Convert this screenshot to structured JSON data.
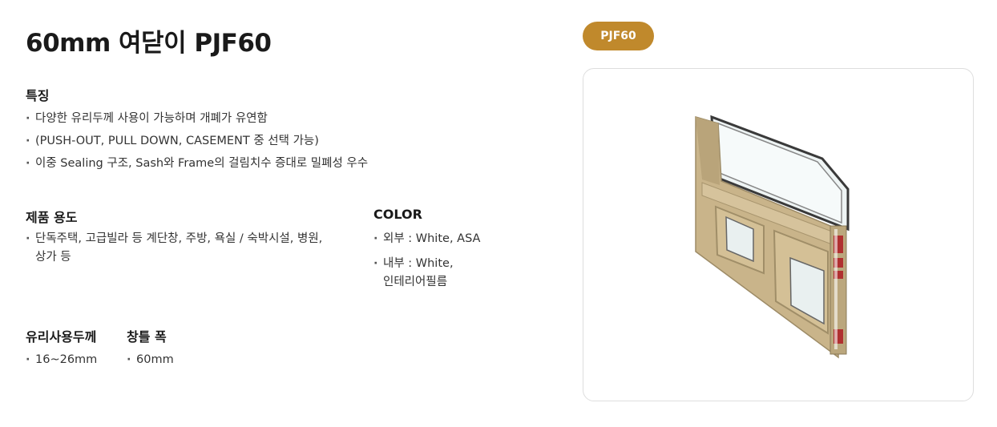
{
  "product": {
    "title": "60mm 여닫이 PJF60",
    "badge": "PJF60",
    "image_icon": "window-frame-product-image"
  },
  "features": {
    "heading": "특징",
    "items": [
      "다양한 유리두께 사용이 가능하며 개폐가 유연함",
      "(PUSH-OUT, PULL DOWN, CASEMENT 중 선택 가능)",
      "이중 Sealing 구조, Sash와 Frame의 걸림치수 증대로 밀폐성 우수"
    ]
  },
  "usage": {
    "heading": "제품 용도",
    "items": [
      {
        "line1": "단독주택, 고급빌라 등 계단창, 주방, 욕실 / 숙박시설, 병원,",
        "line2": "상가 등"
      }
    ]
  },
  "color": {
    "heading": "COLOR",
    "items": [
      {
        "line1": "외부 : White, ASA",
        "line2": ""
      },
      {
        "line1": "내부 : White,",
        "line2": "인테리어필름"
      }
    ]
  },
  "glass": {
    "heading": "유리사용두께",
    "items": [
      "16~26mm"
    ]
  },
  "frame_width": {
    "heading": "창틀 폭",
    "items": [
      "60mm"
    ]
  },
  "colors": {
    "badge_bg": "#c0892c",
    "frame": "#c9b48a",
    "seal": "#b03030"
  }
}
